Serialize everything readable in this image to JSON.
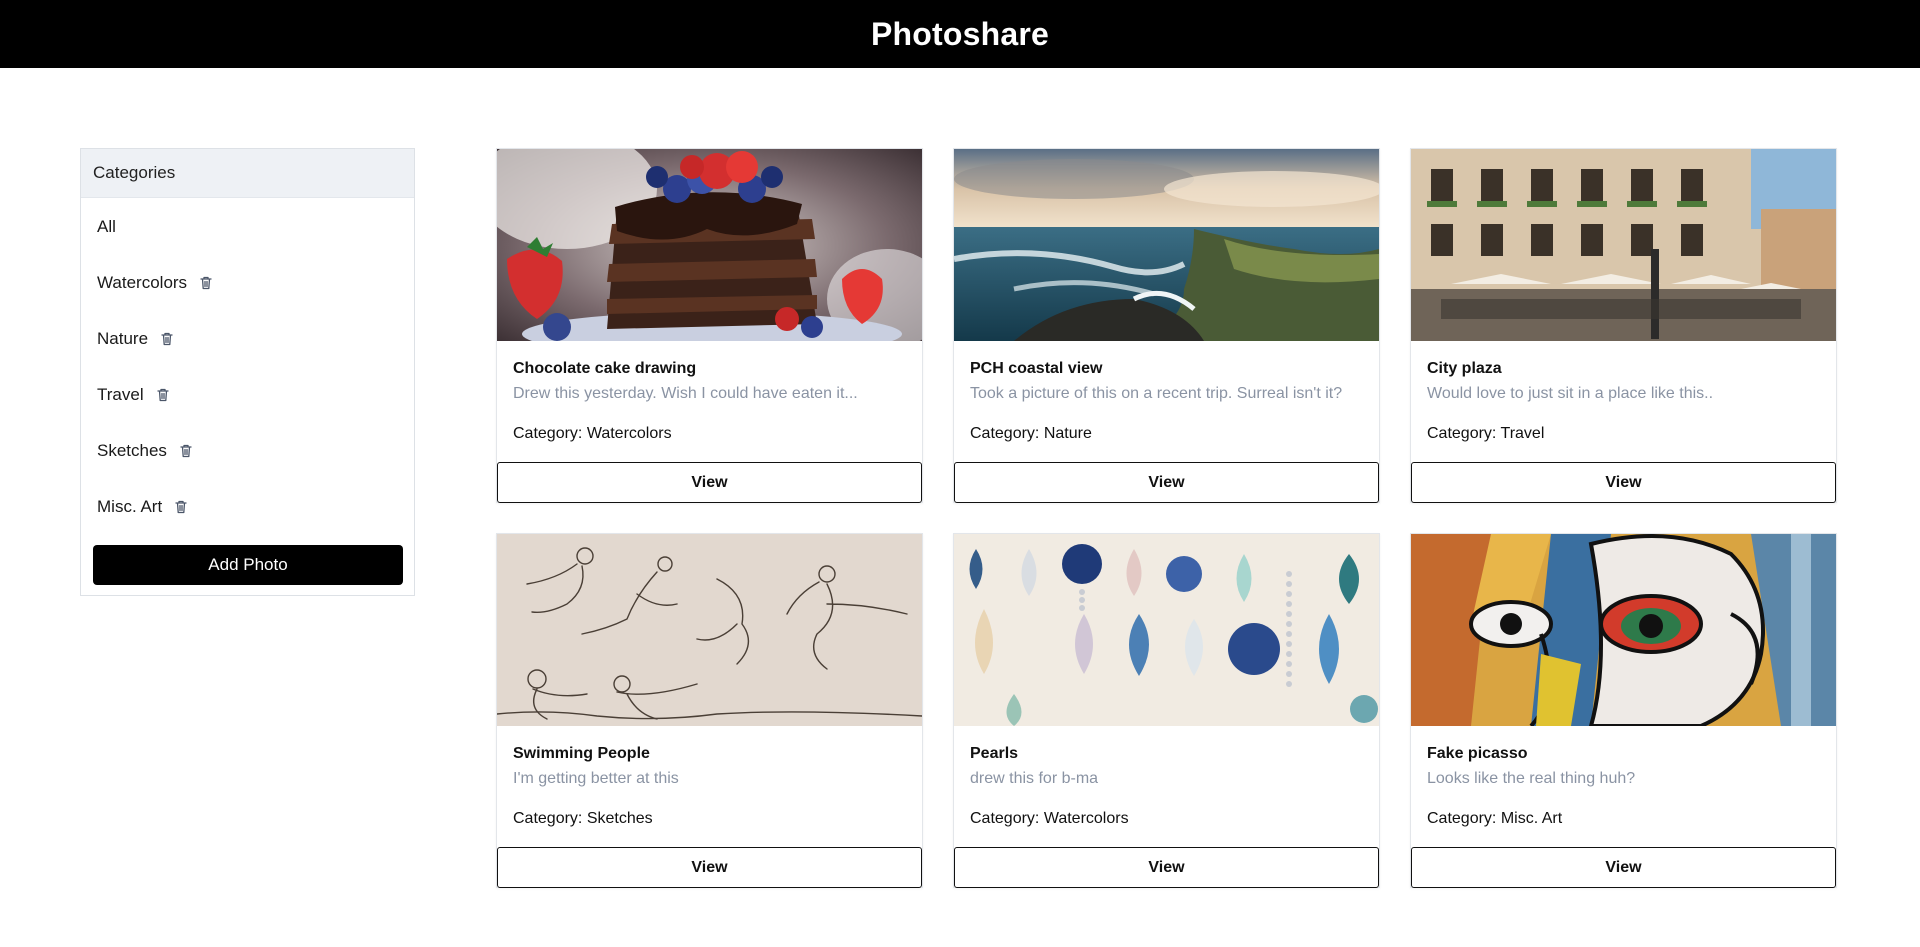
{
  "app": {
    "title": "Photoshare"
  },
  "sidebar": {
    "header": "Categories",
    "items": [
      {
        "label": "All",
        "deletable": false
      },
      {
        "label": "Watercolors",
        "deletable": true
      },
      {
        "label": "Nature",
        "deletable": true
      },
      {
        "label": "Travel",
        "deletable": true
      },
      {
        "label": "Sketches",
        "deletable": true
      },
      {
        "label": "Misc. Art",
        "deletable": true
      }
    ],
    "add_button": "Add Photo"
  },
  "photos": [
    {
      "title": "Chocolate cake drawing",
      "description": "Drew this yesterday. Wish I could have eaten it...",
      "category": "Category: Watercolors",
      "view_label": "View",
      "image": "chocolate-cake-watercolor"
    },
    {
      "title": "PCH coastal view",
      "description": "Took a picture of this on a recent trip. Surreal isn't it?",
      "category": "Category: Nature",
      "view_label": "View",
      "image": "coastal-cliffs-ocean"
    },
    {
      "title": "City plaza",
      "description": "Would love to just sit in a place like this..",
      "category": "Category: Travel",
      "view_label": "View",
      "image": "european-city-plaza"
    },
    {
      "title": "Swimming People",
      "description": "I'm getting better at this",
      "category": "Category: Sketches",
      "view_label": "View",
      "image": "swimmers-sketch"
    },
    {
      "title": "Pearls",
      "description": "drew this for b-ma",
      "category": "Category: Watercolors",
      "view_label": "View",
      "image": "watercolor-pearls"
    },
    {
      "title": "Fake picasso",
      "description": "Looks like the real thing huh?",
      "category": "Category: Misc. Art",
      "view_label": "View",
      "image": "cubist-face"
    }
  ],
  "colors": {
    "topbar": "#000000",
    "sidebar_header_bg": "#eef1f5",
    "muted_text": "#8a93a3",
    "button_dark": "#000000"
  }
}
